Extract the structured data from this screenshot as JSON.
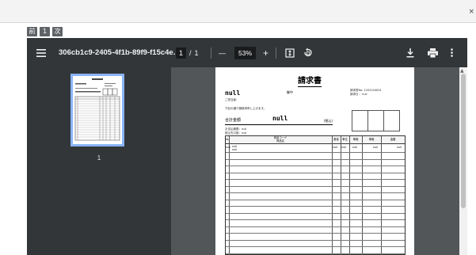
{
  "top_pager": {
    "buttons": [
      "前",
      "1",
      "次"
    ]
  },
  "toolbar": {
    "filename": "306cb1c9-2405-4f1b-89f9-f15c4e...",
    "current_page": "1",
    "page_separator": "/",
    "total_pages": "1",
    "zoom_out": "—",
    "zoom_level": "53%",
    "zoom_in": "+",
    "icons": [
      "menu-icon",
      "fit-page-icon",
      "rotate-icon",
      "download-icon",
      "print-icon",
      "more-options-icon"
    ]
  },
  "sidebar": {
    "thumbnail_label": "1"
  },
  "document": {
    "title": "請求書",
    "recipient": "null",
    "honorific": "御中",
    "invoice_no": "請求書No: 1202104001",
    "invoice_date": "請求日： null",
    "contact_line": "ご担当者：",
    "intro": "下記の通り御請求申し上げます。",
    "total_label": "合計金額",
    "total_value": "null",
    "tax_note": "(税込)",
    "payment_due": "お支払期限：null",
    "bank_info": "振込先口座：null",
    "table_headers": [
      "№",
      "商品コード",
      "商品名",
      "数量",
      "単位",
      "単価",
      "単価",
      "金額"
    ],
    "table_row": {
      "no": "null",
      "code": "null",
      "name": "null",
      "qty": "null",
      "unit": "null",
      "price": "null",
      "price2": "null",
      "amount": "null"
    }
  }
}
